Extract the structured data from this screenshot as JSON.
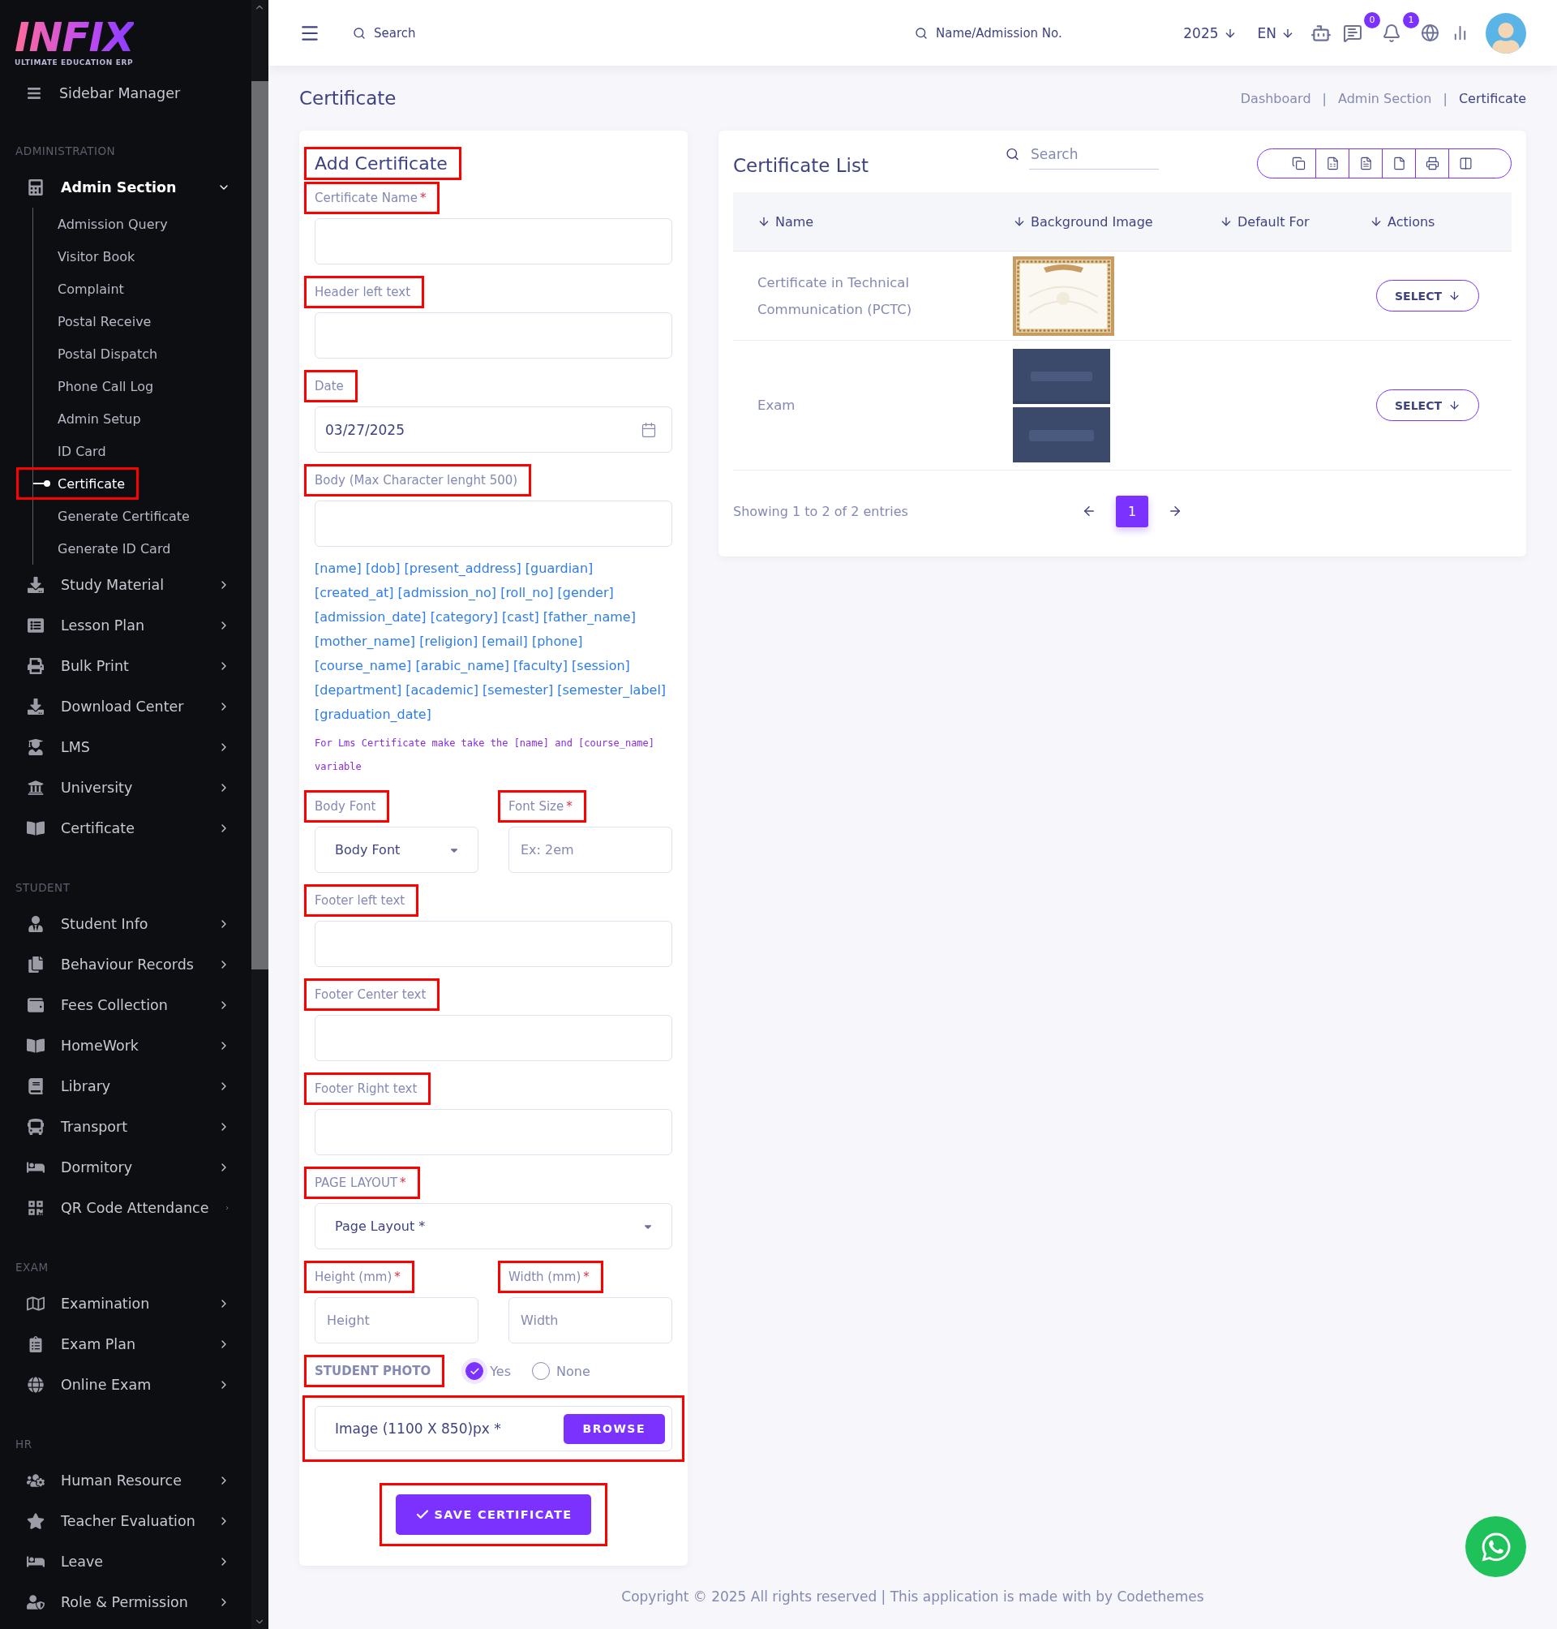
{
  "sidebar": {
    "logo": {
      "name": "INFIX",
      "tagline": "ULTIMATE EDUCATION ERP"
    },
    "manager": "Sidebar Manager",
    "sections": [
      {
        "title": "ADMINISTRATION",
        "items": [
          {
            "label": "Admin Section",
            "expanded": true,
            "children": [
              {
                "label": "Admission Query",
                "selected": false,
                "highlighted": false
              },
              {
                "label": "Visitor Book",
                "selected": false,
                "highlighted": false
              },
              {
                "label": "Complaint",
                "selected": false,
                "highlighted": false
              },
              {
                "label": "Postal Receive",
                "selected": false,
                "highlighted": false
              },
              {
                "label": "Postal Dispatch",
                "selected": false,
                "highlighted": false
              },
              {
                "label": "Phone Call Log",
                "selected": false,
                "highlighted": false
              },
              {
                "label": "Admin Setup",
                "selected": false,
                "highlighted": false
              },
              {
                "label": "ID Card",
                "selected": false,
                "highlighted": false
              },
              {
                "label": "Certificate",
                "selected": true,
                "highlighted": true
              },
              {
                "label": "Generate Certificate",
                "selected": false,
                "highlighted": false
              },
              {
                "label": "Generate ID Card",
                "selected": false,
                "highlighted": false
              }
            ]
          },
          {
            "label": "Study Material",
            "expanded": false
          },
          {
            "label": "Lesson Plan",
            "expanded": false
          },
          {
            "label": "Bulk Print",
            "expanded": false
          },
          {
            "label": "Download Center",
            "expanded": false
          },
          {
            "label": "LMS",
            "expanded": false
          },
          {
            "label": "University",
            "expanded": false
          },
          {
            "label": "Certificate",
            "expanded": false
          }
        ]
      },
      {
        "title": "STUDENT",
        "items": [
          {
            "label": "Student Info",
            "expanded": false
          },
          {
            "label": "Behaviour Records",
            "expanded": false
          },
          {
            "label": "Fees Collection",
            "expanded": false
          },
          {
            "label": "HomeWork",
            "expanded": false
          },
          {
            "label": "Library",
            "expanded": false
          },
          {
            "label": "Transport",
            "expanded": false
          },
          {
            "label": "Dormitory",
            "expanded": false
          },
          {
            "label": "QR Code Attendance",
            "expanded": false
          }
        ]
      },
      {
        "title": "EXAM",
        "items": [
          {
            "label": "Examination",
            "expanded": false
          },
          {
            "label": "Exam Plan",
            "expanded": false
          },
          {
            "label": "Online Exam",
            "expanded": false
          }
        ]
      },
      {
        "title": "HR",
        "items": [
          {
            "label": "Human Resource",
            "expanded": false
          },
          {
            "label": "Teacher Evaluation",
            "expanded": false
          },
          {
            "label": "Leave",
            "expanded": false
          },
          {
            "label": "Role & Permission",
            "expanded": false
          }
        ]
      }
    ]
  },
  "header": {
    "search": {
      "placeholder": "Search"
    },
    "student_search": {
      "placeholder": "Name/Admission No."
    },
    "year": "2025",
    "language": "EN",
    "messages_badge": "0",
    "notifications_badge": "1"
  },
  "page": {
    "title": "Certificate",
    "breadcrumbs": [
      {
        "label": "Dashboard",
        "selected": false,
        "separator": "|"
      },
      {
        "label": "Admin Section",
        "selected": false,
        "separator": "|"
      },
      {
        "label": "Certificate",
        "selected": true
      }
    ]
  },
  "form": {
    "title": "Add Certificate",
    "title_highlighted": true,
    "rows": [
      {
        "kind": "single",
        "fields": [
          {
            "label": "Certificate Name",
            "mark": "*",
            "highlighted": true,
            "kind": "text"
          }
        ]
      },
      {
        "kind": "single",
        "fields": [
          {
            "label": "Header left text",
            "highlighted": true,
            "kind": "text"
          }
        ]
      },
      {
        "kind": "single",
        "fields": [
          {
            "label": "Date",
            "highlighted": true,
            "kind": "date",
            "value": "03/27/2025"
          }
        ]
      },
      {
        "kind": "single",
        "fields": [
          {
            "label": "Body (Max Character lenght 500)",
            "highlighted": true,
            "kind": "text"
          }
        ]
      },
      {
        "kind": "variables",
        "text": "[name] [dob] [present_address] [guardian] [created_at] [admission_no] [roll_no] [gender] [admission_date] [category] [cast] [father_name] [mother_name] [religion] [email] [phone] [course_name] [arabic_name] [faculty] [session] [department] [academic] [semester] [semester_label] [graduation_date]"
      },
      {
        "kind": "note",
        "text": "For Lms Certificate make take the [name] and [course_name] variable"
      },
      {
        "kind": "pair",
        "fields": [
          {
            "label": "Body Font",
            "highlighted": true,
            "kind": "select",
            "value": "Body Font"
          },
          {
            "label": "Font Size",
            "mark": "*",
            "highlighted": true,
            "kind": "text",
            "placeholder": "Ex: 2em"
          }
        ]
      },
      {
        "kind": "single",
        "fields": [
          {
            "label": "Footer left text",
            "highlighted": true,
            "kind": "text"
          }
        ]
      },
      {
        "kind": "single",
        "fields": [
          {
            "label": "Footer Center text",
            "highlighted": true,
            "kind": "text"
          }
        ]
      },
      {
        "kind": "single",
        "fields": [
          {
            "label": "Footer Right text",
            "highlighted": true,
            "kind": "text"
          }
        ]
      },
      {
        "kind": "single",
        "fields": [
          {
            "label": "PAGE LAYOUT",
            "mark": "*",
            "highlighted": true,
            "kind": "select",
            "value": "Page Layout *"
          }
        ]
      },
      {
        "kind": "pair",
        "fields": [
          {
            "label": "Height (mm)",
            "mark": "*",
            "highlighted": true,
            "kind": "text",
            "placeholder": "Height"
          },
          {
            "label": "Width (mm)",
            "mark": "*",
            "highlighted": true,
            "kind": "text",
            "placeholder": "Width"
          }
        ]
      },
      {
        "kind": "radio",
        "label": "STUDENT PHOTO",
        "highlighted": true,
        "options": [
          {
            "label": "Yes",
            "selected": true
          },
          {
            "label": "None",
            "selected": false
          }
        ]
      },
      {
        "kind": "file",
        "placeholder": "Image (1100 X 850)px *",
        "button": "BROWSE",
        "highlighted": true
      },
      {
        "kind": "submit",
        "label": "SAVE CERTIFICATE",
        "highlighted": true
      }
    ]
  },
  "list": {
    "title": "Certificate List",
    "search": {
      "placeholder": "Search"
    },
    "columns": [
      "Name",
      "Background Image",
      "Default For",
      "Actions"
    ],
    "rows": [
      {
        "name": "Certificate in Technical Communication (PCTC)",
        "action": "SELECT"
      },
      {
        "name": "Exam",
        "action": "SELECT"
      }
    ],
    "info": "Showing 1 to 2 of 2 entries",
    "pages": [
      {
        "label": "1",
        "selected": true
      }
    ]
  },
  "footer": "Copyright © 2025 All rights reserved | This application is made with by Codethemes"
}
